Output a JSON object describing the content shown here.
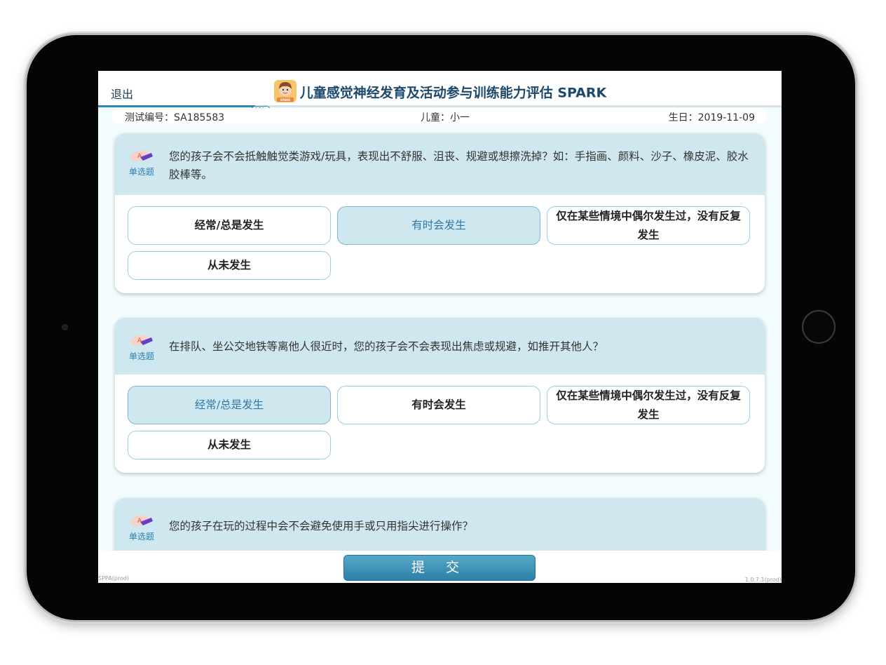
{
  "header": {
    "exit_label": "退出",
    "title": "儿童感觉神经发育及活动参与训练能力评估 SPARK",
    "logo_label": "SPARK"
  },
  "progress": {
    "percent": 23,
    "label": "23%"
  },
  "info": {
    "test_id": "测试编号：SA185583",
    "child": "儿童：小一",
    "birthday": "生日：2019-11-09"
  },
  "questions": [
    {
      "type_label": "单选题",
      "text": "您的孩子会不会抵触触觉类游戏/玩具，表现出不舒服、沮丧、规避或想擦洗掉？如：手指画、颜料、沙子、橡皮泥、胶水胶棒等。",
      "options": [
        "经常/总是发生",
        "有时会发生",
        "仅在某些情境中偶尔发生过，没有反复发生",
        "从未发生"
      ],
      "selected": 1
    },
    {
      "type_label": "单选题",
      "text": "在排队、坐公交地铁等离他人很近时，您的孩子会不会表现出焦虑或规避，如推开其他人？",
      "options": [
        "经常/总是发生",
        "有时会发生",
        "仅在某些情境中偶尔发生过，没有反复发生",
        "从未发生"
      ],
      "selected": 0
    },
    {
      "type_label": "单选题",
      "text": "您的孩子在玩的过程中会不会避免使用手或只用指尖进行操作？"
    }
  ],
  "footer": {
    "submit_label": "提 交",
    "env_label": "SPPA(prod)",
    "version_label": "1.0.7.1(prod)"
  },
  "colors": {
    "accent": "#2f86b5",
    "selected_bg": "#cfe8ef",
    "screen_bg": "#f2fbfd"
  }
}
